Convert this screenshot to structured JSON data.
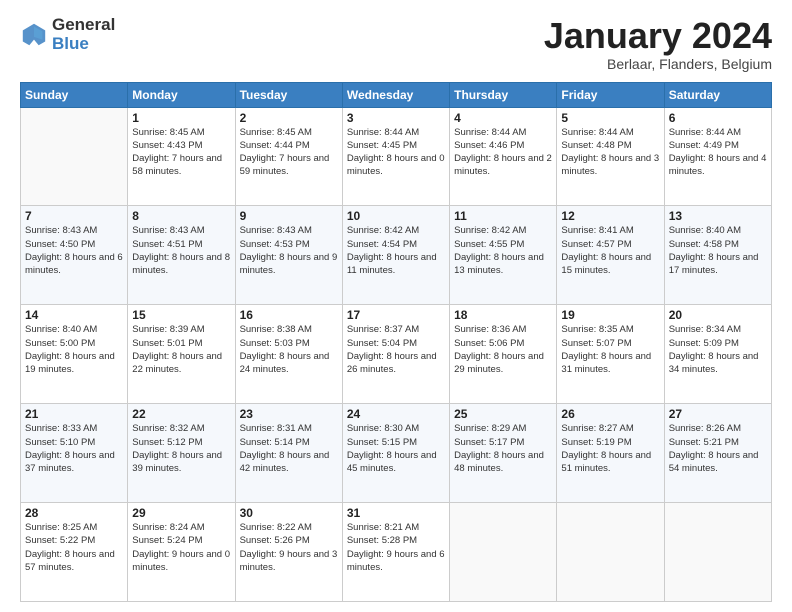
{
  "logo": {
    "general": "General",
    "blue": "Blue"
  },
  "header": {
    "title": "January 2024",
    "subtitle": "Berlaar, Flanders, Belgium"
  },
  "calendar": {
    "days_of_week": [
      "Sunday",
      "Monday",
      "Tuesday",
      "Wednesday",
      "Thursday",
      "Friday",
      "Saturday"
    ],
    "weeks": [
      [
        {
          "num": "",
          "sunrise": "",
          "sunset": "",
          "daylight": ""
        },
        {
          "num": "1",
          "sunrise": "Sunrise: 8:45 AM",
          "sunset": "Sunset: 4:43 PM",
          "daylight": "Daylight: 7 hours and 58 minutes."
        },
        {
          "num": "2",
          "sunrise": "Sunrise: 8:45 AM",
          "sunset": "Sunset: 4:44 PM",
          "daylight": "Daylight: 7 hours and 59 minutes."
        },
        {
          "num": "3",
          "sunrise": "Sunrise: 8:44 AM",
          "sunset": "Sunset: 4:45 PM",
          "daylight": "Daylight: 8 hours and 0 minutes."
        },
        {
          "num": "4",
          "sunrise": "Sunrise: 8:44 AM",
          "sunset": "Sunset: 4:46 PM",
          "daylight": "Daylight: 8 hours and 2 minutes."
        },
        {
          "num": "5",
          "sunrise": "Sunrise: 8:44 AM",
          "sunset": "Sunset: 4:48 PM",
          "daylight": "Daylight: 8 hours and 3 minutes."
        },
        {
          "num": "6",
          "sunrise": "Sunrise: 8:44 AM",
          "sunset": "Sunset: 4:49 PM",
          "daylight": "Daylight: 8 hours and 4 minutes."
        }
      ],
      [
        {
          "num": "7",
          "sunrise": "Sunrise: 8:43 AM",
          "sunset": "Sunset: 4:50 PM",
          "daylight": "Daylight: 8 hours and 6 minutes."
        },
        {
          "num": "8",
          "sunrise": "Sunrise: 8:43 AM",
          "sunset": "Sunset: 4:51 PM",
          "daylight": "Daylight: 8 hours and 8 minutes."
        },
        {
          "num": "9",
          "sunrise": "Sunrise: 8:43 AM",
          "sunset": "Sunset: 4:53 PM",
          "daylight": "Daylight: 8 hours and 9 minutes."
        },
        {
          "num": "10",
          "sunrise": "Sunrise: 8:42 AM",
          "sunset": "Sunset: 4:54 PM",
          "daylight": "Daylight: 8 hours and 11 minutes."
        },
        {
          "num": "11",
          "sunrise": "Sunrise: 8:42 AM",
          "sunset": "Sunset: 4:55 PM",
          "daylight": "Daylight: 8 hours and 13 minutes."
        },
        {
          "num": "12",
          "sunrise": "Sunrise: 8:41 AM",
          "sunset": "Sunset: 4:57 PM",
          "daylight": "Daylight: 8 hours and 15 minutes."
        },
        {
          "num": "13",
          "sunrise": "Sunrise: 8:40 AM",
          "sunset": "Sunset: 4:58 PM",
          "daylight": "Daylight: 8 hours and 17 minutes."
        }
      ],
      [
        {
          "num": "14",
          "sunrise": "Sunrise: 8:40 AM",
          "sunset": "Sunset: 5:00 PM",
          "daylight": "Daylight: 8 hours and 19 minutes."
        },
        {
          "num": "15",
          "sunrise": "Sunrise: 8:39 AM",
          "sunset": "Sunset: 5:01 PM",
          "daylight": "Daylight: 8 hours and 22 minutes."
        },
        {
          "num": "16",
          "sunrise": "Sunrise: 8:38 AM",
          "sunset": "Sunset: 5:03 PM",
          "daylight": "Daylight: 8 hours and 24 minutes."
        },
        {
          "num": "17",
          "sunrise": "Sunrise: 8:37 AM",
          "sunset": "Sunset: 5:04 PM",
          "daylight": "Daylight: 8 hours and 26 minutes."
        },
        {
          "num": "18",
          "sunrise": "Sunrise: 8:36 AM",
          "sunset": "Sunset: 5:06 PM",
          "daylight": "Daylight: 8 hours and 29 minutes."
        },
        {
          "num": "19",
          "sunrise": "Sunrise: 8:35 AM",
          "sunset": "Sunset: 5:07 PM",
          "daylight": "Daylight: 8 hours and 31 minutes."
        },
        {
          "num": "20",
          "sunrise": "Sunrise: 8:34 AM",
          "sunset": "Sunset: 5:09 PM",
          "daylight": "Daylight: 8 hours and 34 minutes."
        }
      ],
      [
        {
          "num": "21",
          "sunrise": "Sunrise: 8:33 AM",
          "sunset": "Sunset: 5:10 PM",
          "daylight": "Daylight: 8 hours and 37 minutes."
        },
        {
          "num": "22",
          "sunrise": "Sunrise: 8:32 AM",
          "sunset": "Sunset: 5:12 PM",
          "daylight": "Daylight: 8 hours and 39 minutes."
        },
        {
          "num": "23",
          "sunrise": "Sunrise: 8:31 AM",
          "sunset": "Sunset: 5:14 PM",
          "daylight": "Daylight: 8 hours and 42 minutes."
        },
        {
          "num": "24",
          "sunrise": "Sunrise: 8:30 AM",
          "sunset": "Sunset: 5:15 PM",
          "daylight": "Daylight: 8 hours and 45 minutes."
        },
        {
          "num": "25",
          "sunrise": "Sunrise: 8:29 AM",
          "sunset": "Sunset: 5:17 PM",
          "daylight": "Daylight: 8 hours and 48 minutes."
        },
        {
          "num": "26",
          "sunrise": "Sunrise: 8:27 AM",
          "sunset": "Sunset: 5:19 PM",
          "daylight": "Daylight: 8 hours and 51 minutes."
        },
        {
          "num": "27",
          "sunrise": "Sunrise: 8:26 AM",
          "sunset": "Sunset: 5:21 PM",
          "daylight": "Daylight: 8 hours and 54 minutes."
        }
      ],
      [
        {
          "num": "28",
          "sunrise": "Sunrise: 8:25 AM",
          "sunset": "Sunset: 5:22 PM",
          "daylight": "Daylight: 8 hours and 57 minutes."
        },
        {
          "num": "29",
          "sunrise": "Sunrise: 8:24 AM",
          "sunset": "Sunset: 5:24 PM",
          "daylight": "Daylight: 9 hours and 0 minutes."
        },
        {
          "num": "30",
          "sunrise": "Sunrise: 8:22 AM",
          "sunset": "Sunset: 5:26 PM",
          "daylight": "Daylight: 9 hours and 3 minutes."
        },
        {
          "num": "31",
          "sunrise": "Sunrise: 8:21 AM",
          "sunset": "Sunset: 5:28 PM",
          "daylight": "Daylight: 9 hours and 6 minutes."
        },
        {
          "num": "",
          "sunrise": "",
          "sunset": "",
          "daylight": ""
        },
        {
          "num": "",
          "sunrise": "",
          "sunset": "",
          "daylight": ""
        },
        {
          "num": "",
          "sunrise": "",
          "sunset": "",
          "daylight": ""
        }
      ]
    ]
  }
}
